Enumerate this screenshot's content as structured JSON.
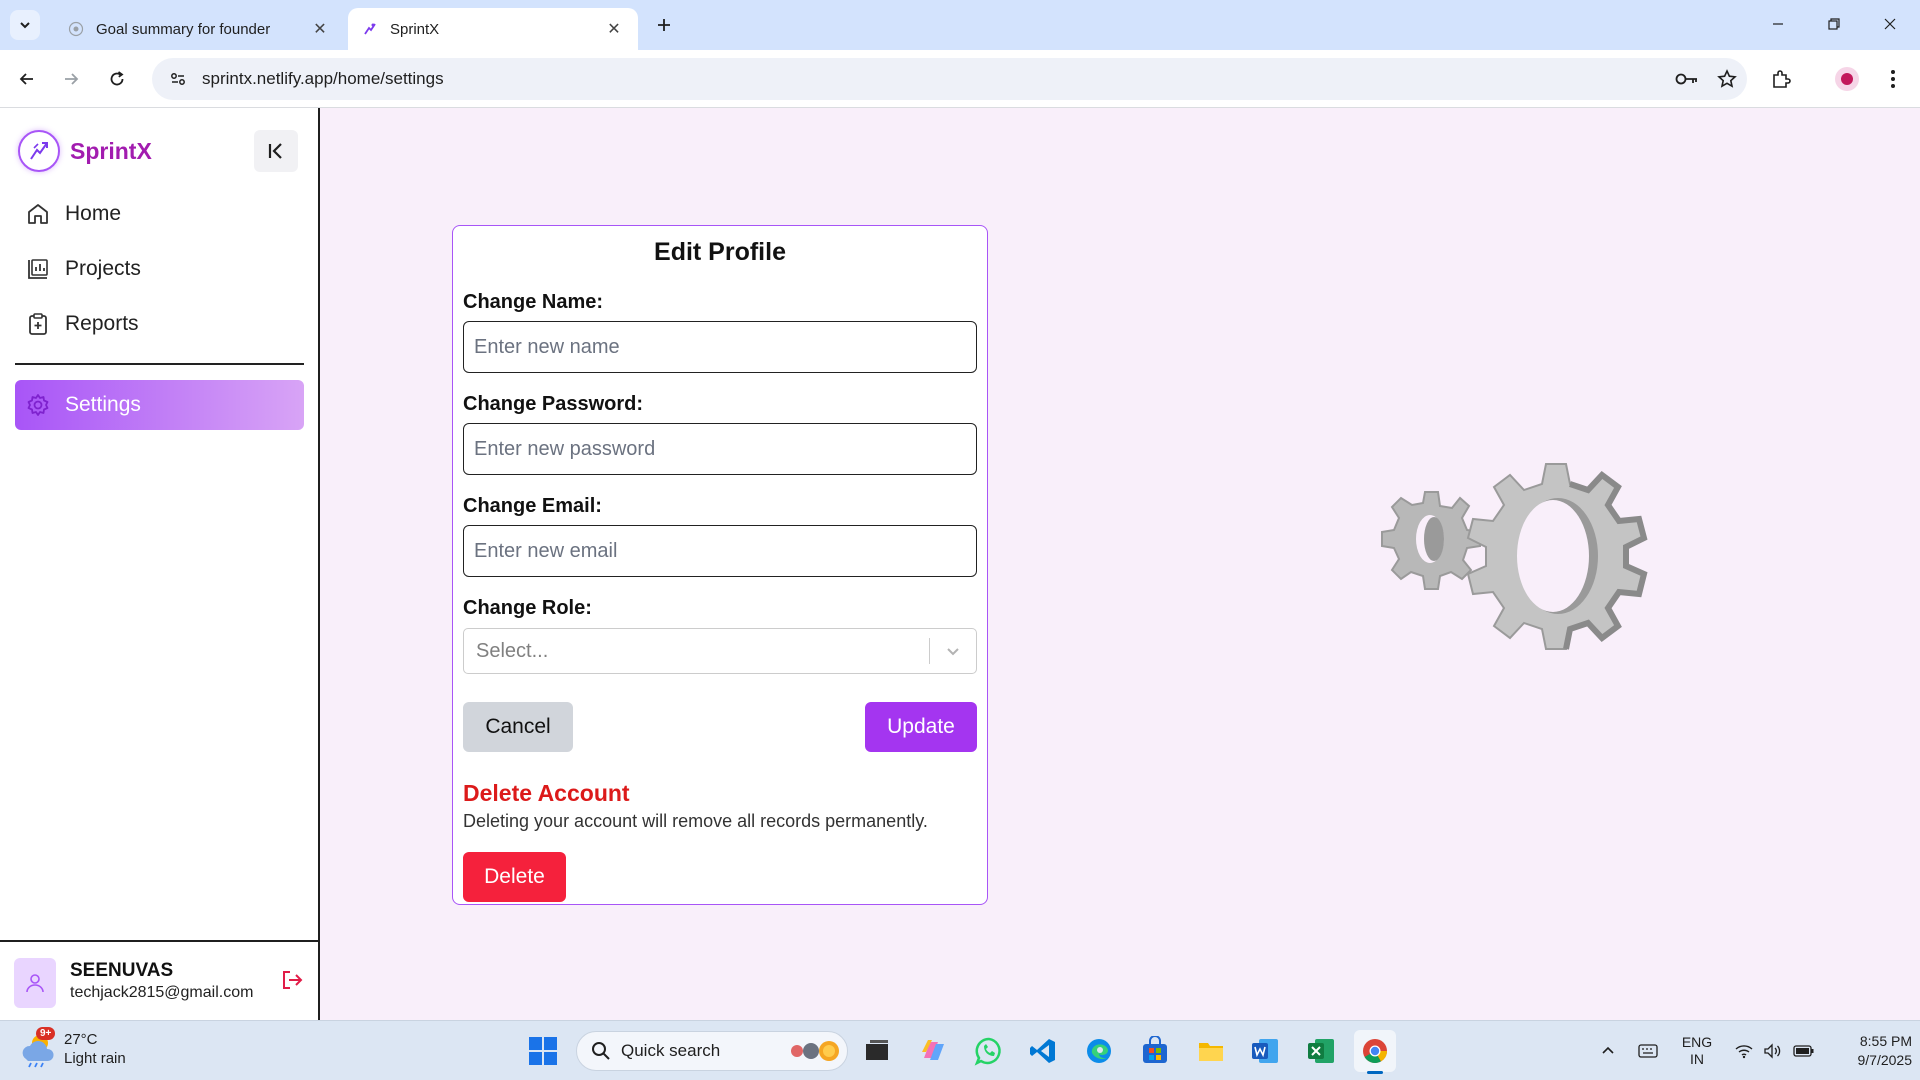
{
  "browser": {
    "tabs": [
      {
        "title": "Goal summary for founder",
        "active": false
      },
      {
        "title": "SprintX",
        "active": true
      }
    ],
    "url": "sprintx.netlify.app/home/settings"
  },
  "sidebar": {
    "brand": "SprintX",
    "nav": [
      {
        "label": "Home",
        "icon": "home-icon"
      },
      {
        "label": "Projects",
        "icon": "chart-icon"
      },
      {
        "label": "Reports",
        "icon": "clipboard-plus-icon"
      },
      {
        "label": "Settings",
        "icon": "gear-icon",
        "active": true
      }
    ],
    "user": {
      "name": "SEENUVAS",
      "email": "techjack2815@gmail.com"
    }
  },
  "edit_profile": {
    "title": "Edit Profile",
    "name_label": "Change Name:",
    "name_placeholder": "Enter new name",
    "password_label": "Change Password:",
    "password_placeholder": "Enter new password",
    "email_label": "Change Email:",
    "email_placeholder": "Enter new email",
    "role_label": "Change Role:",
    "role_placeholder": "Select...",
    "cancel_label": "Cancel",
    "update_label": "Update",
    "delete_title": "Delete Account",
    "delete_text": "Deleting your account will remove all records permanently.",
    "delete_label": "Delete"
  },
  "taskbar": {
    "weather": {
      "temp": "27°C",
      "condition": "Light rain",
      "badge": "9+"
    },
    "search_placeholder": "Quick search",
    "lang_top": "ENG",
    "lang_bottom": "IN",
    "time": "8:55 PM",
    "date": "9/7/2025"
  },
  "colors": {
    "accent": "#a855f7",
    "brand_text": "#a21caf",
    "danger": "#dc1a1a",
    "delete_button": "#f5213c",
    "app_background": "#f9effa"
  }
}
